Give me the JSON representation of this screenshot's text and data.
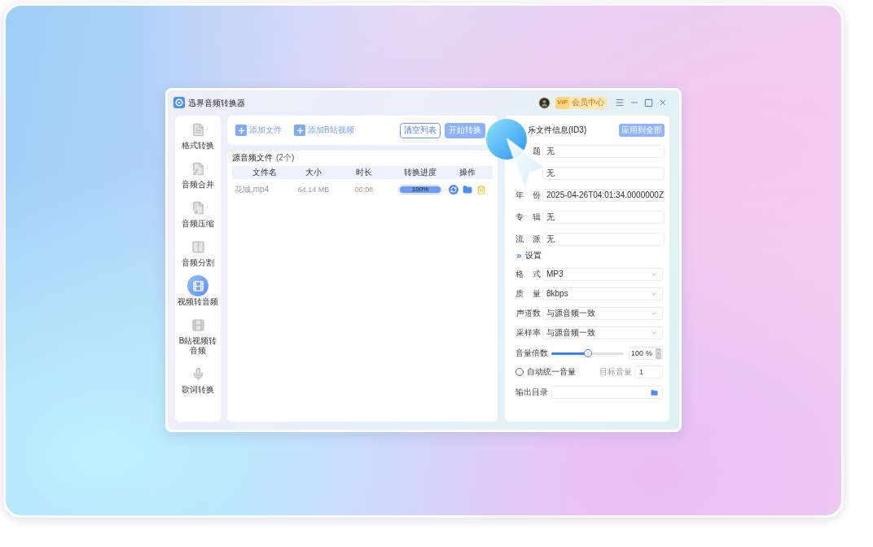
{
  "window": {
    "title": "迅界音频转换器",
    "member_badge": {
      "tag": "VIP",
      "label": "会员中心"
    }
  },
  "sidebar": {
    "items": [
      {
        "kind": "convert",
        "label": "格式转换",
        "selected": false
      },
      {
        "kind": "merge",
        "label": "音频合并",
        "selected": false
      },
      {
        "kind": "compress",
        "label": "音频压缩",
        "selected": false
      },
      {
        "kind": "split",
        "label": "音频分割",
        "selected": false
      },
      {
        "kind": "video",
        "label": "视频转音频",
        "selected": true
      },
      {
        "kind": "bilibili",
        "label": "B站视频转音频",
        "selected": false
      },
      {
        "kind": "lyrics",
        "label": "歌词转换",
        "selected": false
      }
    ]
  },
  "toolbar": {
    "add_buttons": [
      "添加文件",
      "添加B站视频"
    ],
    "clear_button": "清空列表",
    "start_button": "开始转换"
  },
  "file_list": {
    "title": "源音频文件",
    "count": "(2个)",
    "columns": [
      "文件名",
      "大小",
      "时长",
      "转换进度",
      "操作"
    ],
    "rows": [
      {
        "name": "花城.mp4",
        "size": "64.14 MB",
        "duration": "00:08",
        "progress": {
          "level": 1,
          "label": "100%"
        }
      }
    ]
  },
  "id3": {
    "title": "乐文件信息(ID3)",
    "apply_button": "应用到全部",
    "fields": [
      {
        "label": "题",
        "value": "无"
      },
      {
        "value": "无"
      },
      {
        "label": "年 份",
        "value": "2025-04-26T04:01:34.0000000Z"
      },
      {
        "label": "专 辑",
        "value": "无"
      },
      {
        "label": "流 派",
        "value": "无"
      }
    ]
  },
  "settings": {
    "title": "设置",
    "selects": [
      {
        "label": "格 式",
        "value": "MP3"
      },
      {
        "label": "质 量",
        "value": "8kbps"
      },
      {
        "label": "声道数",
        "value": "与源音频一致"
      },
      {
        "label": "采样率",
        "value": "与源音频一致"
      }
    ],
    "volume": {
      "label": "音量倍数",
      "level": 0.5,
      "value": "100",
      "unit": "%"
    },
    "auto_volume": {
      "label": "自动统一音量",
      "checked": false
    },
    "target_volume": {
      "label": "目标音量",
      "value": "1",
      "disabled": true
    },
    "output_dir": {
      "label": "输出目录"
    }
  }
}
